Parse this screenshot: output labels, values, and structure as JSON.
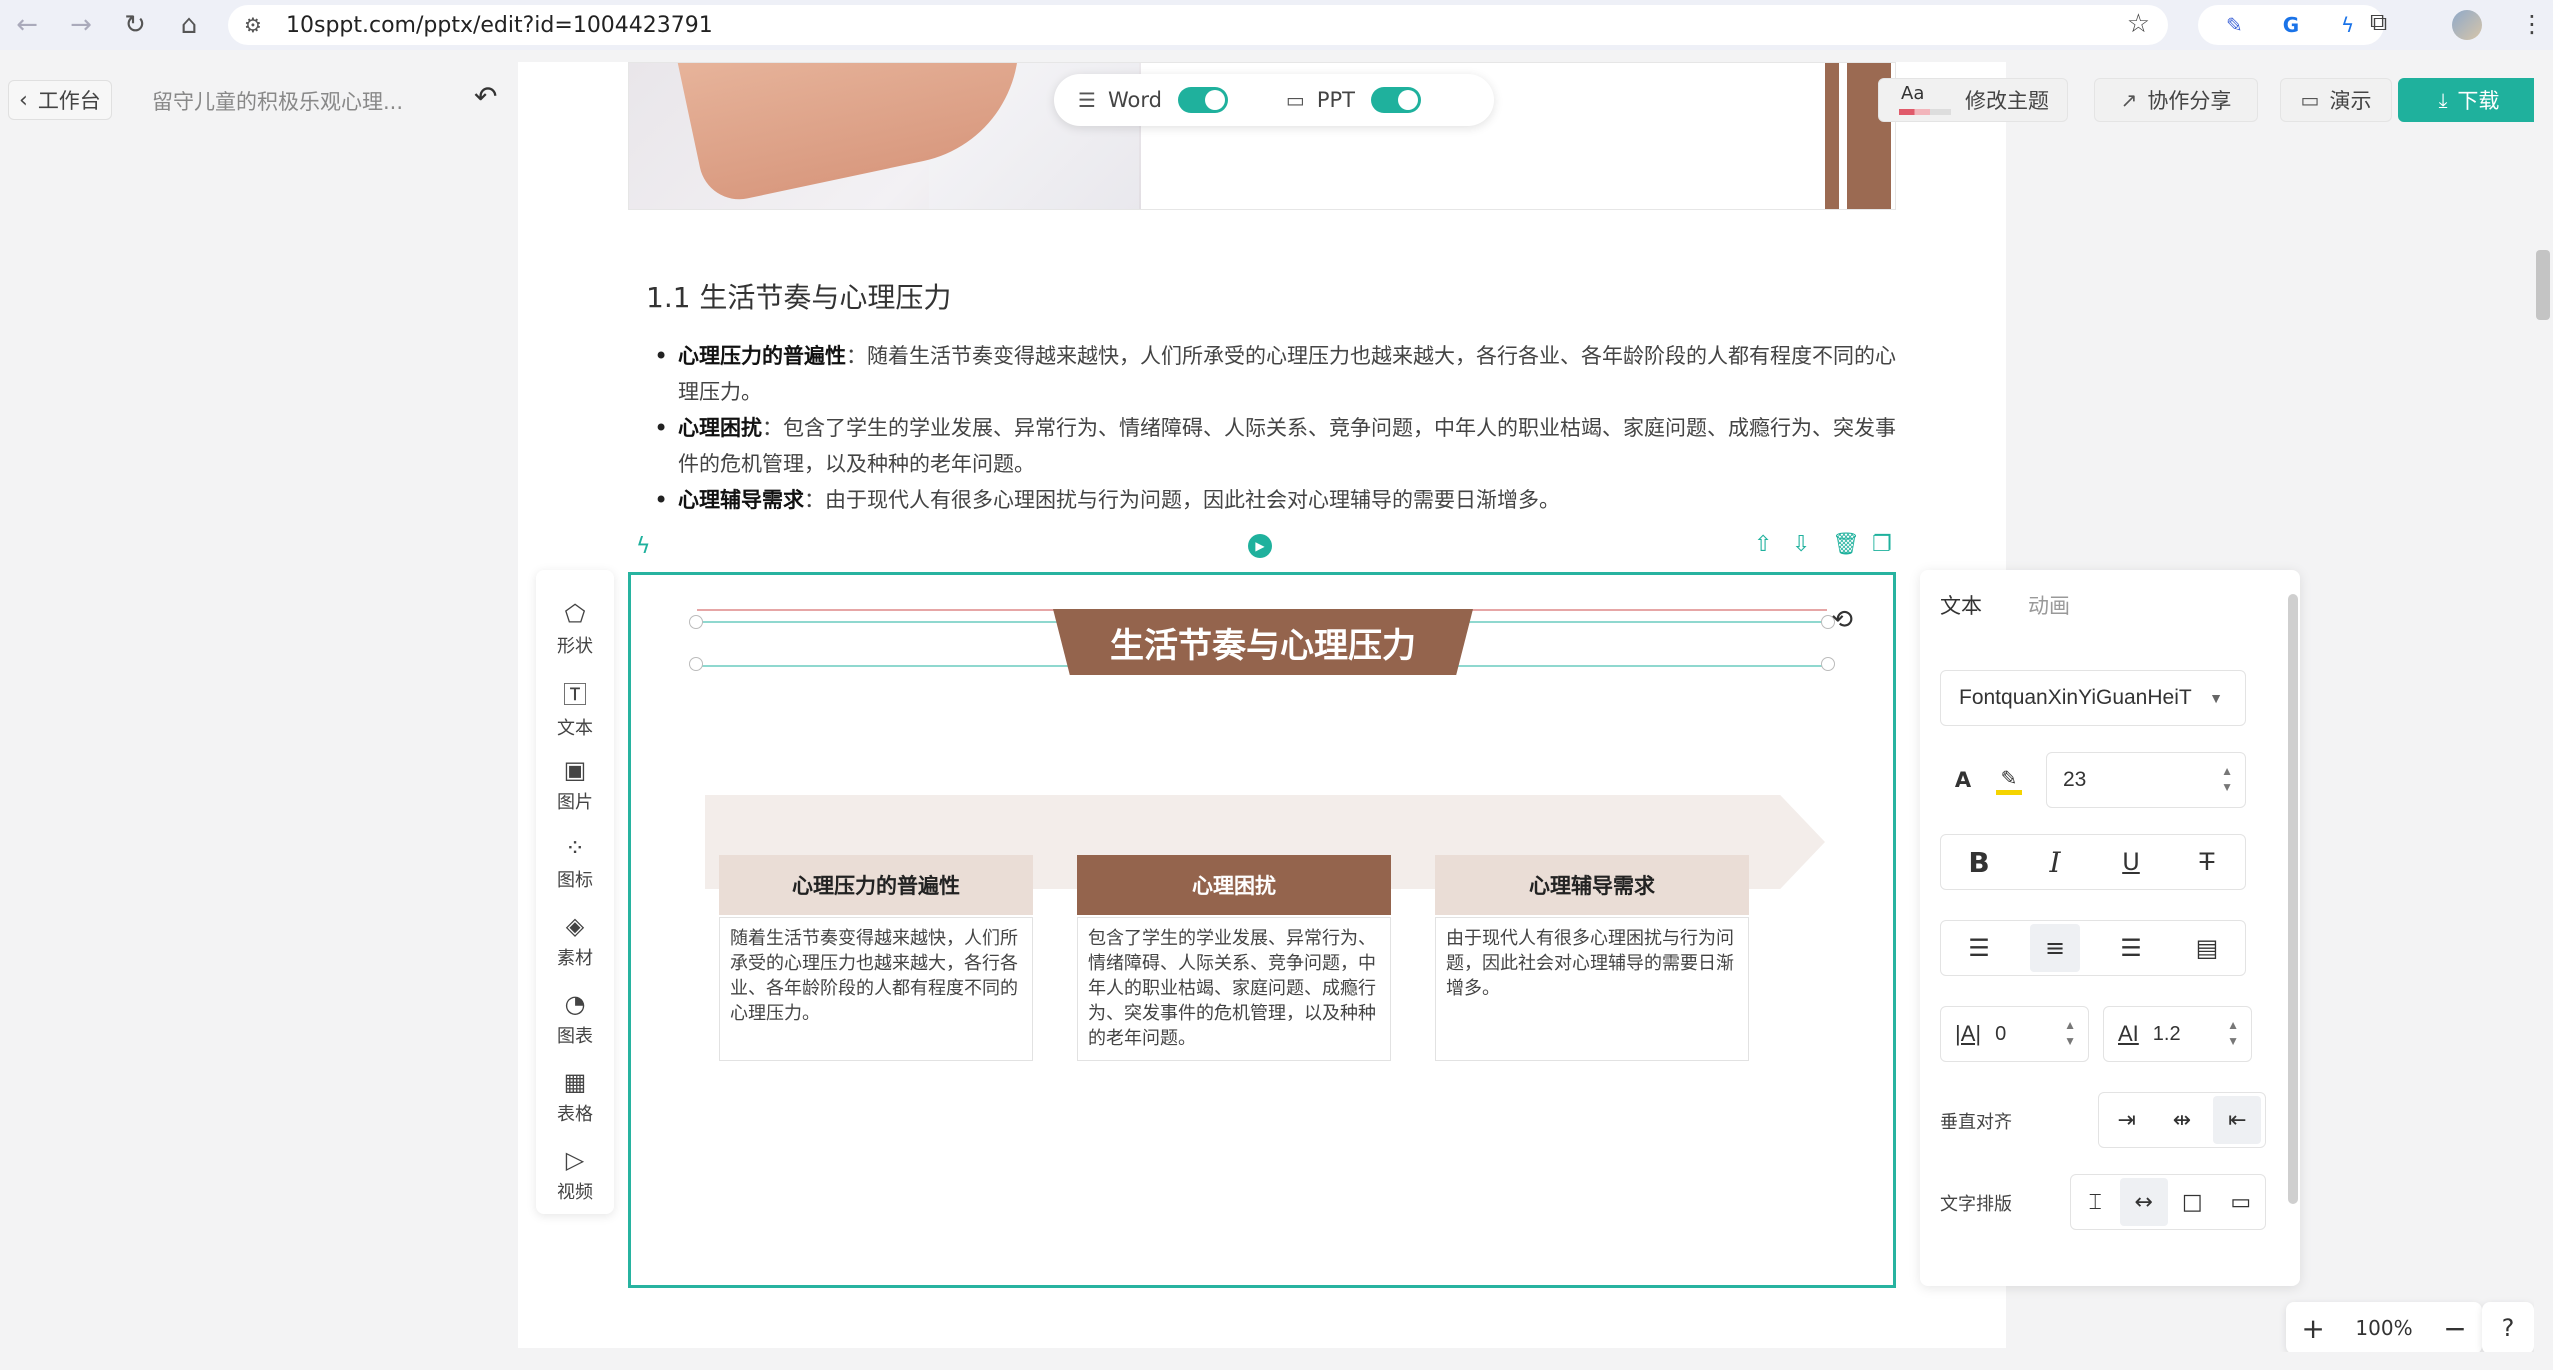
{
  "browser": {
    "url": "10sppt.com/pptx/edit?id=1004423791"
  },
  "app": {
    "back_label": "工作台",
    "doc_title": "留守儿童的积极乐观心理...",
    "theme_label": "修改主题",
    "theme_glyph": "Aa",
    "share_label": "协作分享",
    "present_label": "演示",
    "download_label": "下载",
    "accent_color": "#1fb19d"
  },
  "toggles": {
    "word_label": "Word",
    "word_on": true,
    "ppt_label": "PPT",
    "ppt_on": true
  },
  "document": {
    "heading": "1.1 生活节奏与心理压力",
    "bullets": [
      {
        "title": "心理压力的普遍性",
        "text": "：随着生活节奏变得越来越快，人们所承受的心理压力也越来越大，各行各业、各年龄阶段的人都有程度不同的心理压力。"
      },
      {
        "title": "心理困扰",
        "text": "：包含了学生的学业发展、异常行为、情绪障碍、人际关系、竞争问题，中年人的职业枯竭、家庭问题、成瘾行为、突发事件的危机管理，以及种种的老年问题。"
      },
      {
        "title": "心理辅导需求",
        "text": "：由于现代人有很多心理困扰与行为问题，因此社会对心理辅导的需要日渐增多。"
      }
    ]
  },
  "slide": {
    "title": "生活节奏与心理压力",
    "brand_color": "#94644d",
    "cards": [
      {
        "title": "心理压力的普遍性",
        "text": "随着生活节奏变得越来越快，人们所承受的心理压力也越来越大，各行各业、各年龄阶段的人都有程度不同的心理压力。"
      },
      {
        "title": "心理困扰",
        "text": "包含了学生的学业发展、异常行为、情绪障碍、人际关系、竞争问题，中年人的职业枯竭、家庭问题、成瘾行为、突发事件的危机管理，以及种种的老年问题。"
      },
      {
        "title": "心理辅导需求",
        "text": "由于现代人有很多心理困扰与行为问题，因此社会对心理辅导的需要日渐增多。"
      }
    ]
  },
  "tools": [
    {
      "label": "形状",
      "icon": "shape-icon"
    },
    {
      "label": "文本",
      "icon": "text-icon"
    },
    {
      "label": "图片",
      "icon": "image-icon"
    },
    {
      "label": "图标",
      "icon": "icon-library-icon"
    },
    {
      "label": "素材",
      "icon": "layers-icon"
    },
    {
      "label": "图表",
      "icon": "chart-icon"
    },
    {
      "label": "表格",
      "icon": "table-icon"
    },
    {
      "label": "视频",
      "icon": "video-icon"
    }
  ],
  "properties": {
    "tab_text": "文本",
    "tab_animation": "动画",
    "font_family": "FontquanXinYiGuanHeiT",
    "font_color_glyph": "A",
    "font_size": "23",
    "letter_spacing": "0",
    "line_height": "1.2",
    "vertical_align_label": "垂直对齐",
    "text_layout_label": "文字排版"
  },
  "zoom": {
    "level": "100%"
  }
}
